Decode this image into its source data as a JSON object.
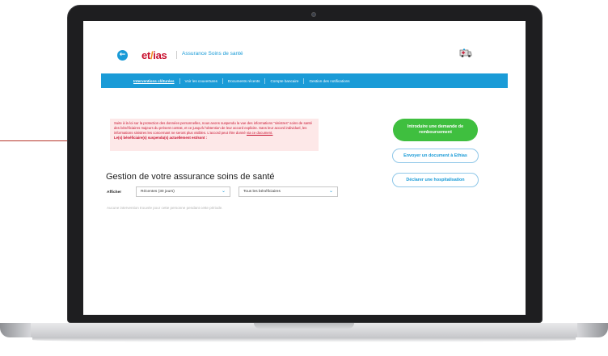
{
  "header": {
    "back_icon": "arrow-left-icon",
    "logo_text_1": "et",
    "logo_slash": "/",
    "logo_text_2": "ias",
    "app_title": "Assurance Soins de santé",
    "profile_icon": "ambulance-icon"
  },
  "nav": {
    "items": [
      {
        "label": "Interventions clôturées"
      },
      {
        "label": "Voir les couvertures"
      },
      {
        "label": "Documents récents"
      },
      {
        "label": "Compte bancaire"
      },
      {
        "label": "Gestion des notifications"
      }
    ]
  },
  "alert": {
    "text": "Suite à la loi sur la protection des données personnelles, nous avons suspendu la vue des informations \"sinistres\" soins de santé des bénéficiaires majeurs du présent contrat, et ce jusqu'à l'obtention de leur accord explicite. Sans leur accord individuel, les informations sinistres les concernant ne seront plus visibles. L'accord peut être donné",
    "link": "via ce document.",
    "strong": "Le(s) bénéficiaire(s) suspendu(s) actuellement est/sont :"
  },
  "actions": {
    "primary": "Introduire une demande de remboursement",
    "send_doc": "Envoyer un document à Ethias",
    "hospital": "Déclarer une hospitalisation"
  },
  "main": {
    "title": "Gestion de votre assurance soins de santé",
    "filter_label": "Afficher",
    "period_value": "Récentes (30 jours)",
    "beneficiary_value": "Tous les bénéficiaires",
    "empty_message": "Aucune intervention trouvée pour cette personne pendant cette période."
  },
  "colors": {
    "brand_blue": "#1a9bd7",
    "brand_red": "#c8102e",
    "cta_green": "#3fbf3f",
    "alert_bg": "#fde8e8"
  }
}
